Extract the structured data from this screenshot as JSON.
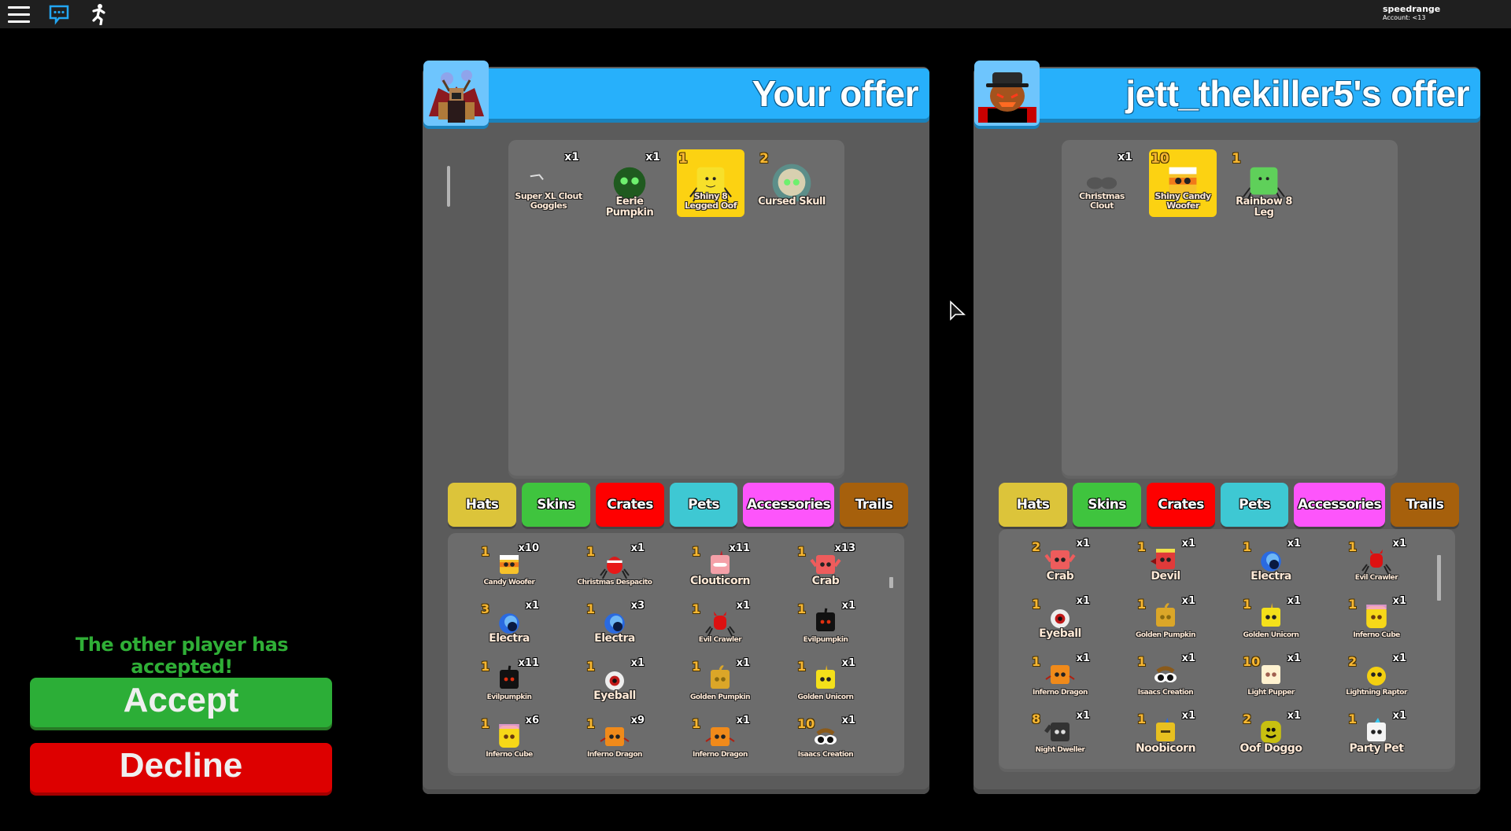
{
  "topbar": {
    "menu_icon": "hamburger-menu-icon",
    "chat_icon": "chat-icon",
    "emote_icon": "emote-running-icon",
    "account_name": "speedrange",
    "account_age": "Account: <13"
  },
  "status_message": "The other player has accepted!",
  "buttons": {
    "accept": "Accept",
    "decline": "Decline"
  },
  "colors": {
    "header_blue": "#27b0fb",
    "shiny_gold": "#fcd212",
    "tier_gold": "#f7b733",
    "accept_green": "#2cae37",
    "decline_red": "#dd0000",
    "status_green": "#2fae36"
  },
  "tabs": [
    {
      "label": "Hats",
      "color": "#dcc43a"
    },
    {
      "label": "Skins",
      "color": "#3fc43e"
    },
    {
      "label": "Crates",
      "color": "#fe0000"
    },
    {
      "label": "Pets",
      "color": "#3ec8d3"
    },
    {
      "label": "Accessories",
      "color": "#fd55fb"
    },
    {
      "label": "Trails",
      "color": "#a6600c"
    }
  ],
  "your_offer": {
    "title": "Your offer",
    "avatar": "player-avatar-speedrange",
    "offered_items": [
      {
        "name": "Super XL Clout Goggles",
        "qty": "x1",
        "tier": "",
        "shiny": false,
        "icon": "goggles"
      },
      {
        "name": "Eerie Pumpkin",
        "qty": "x1",
        "tier": "",
        "shiny": false,
        "icon": "eerie-pumpkin"
      },
      {
        "name": "Shiny 8 Legged Oof",
        "qty": "",
        "tier": "1",
        "shiny": true,
        "icon": "oof-spider"
      },
      {
        "name": "Cursed Skull",
        "qty": "",
        "tier": "2",
        "shiny": false,
        "icon": "cursed-skull"
      }
    ],
    "inventory": [
      {
        "name": "Candy Woofer",
        "tier": "1",
        "qty": "x10",
        "icon": "candy-woofer"
      },
      {
        "name": "Christmas Despacito",
        "tier": "1",
        "qty": "x1",
        "icon": "christmas-despacito"
      },
      {
        "name": "Clouticorn",
        "tier": "1",
        "qty": "x11",
        "icon": "clouticorn"
      },
      {
        "name": "Crab",
        "tier": "1",
        "qty": "x13",
        "icon": "crab"
      },
      {
        "name": "Electra",
        "tier": "3",
        "qty": "x1",
        "icon": "electra"
      },
      {
        "name": "Electra",
        "tier": "1",
        "qty": "x3",
        "icon": "electra"
      },
      {
        "name": "Evil Crawler",
        "tier": "1",
        "qty": "x1",
        "icon": "evil-crawler"
      },
      {
        "name": "Evilpumpkin",
        "tier": "1",
        "qty": "x1",
        "icon": "evilpumpkin"
      },
      {
        "name": "Evilpumpkin",
        "tier": "1",
        "qty": "x11",
        "icon": "evilpumpkin"
      },
      {
        "name": "Eyeball",
        "tier": "1",
        "qty": "x1",
        "icon": "eyeball"
      },
      {
        "name": "Golden Pumpkin",
        "tier": "1",
        "qty": "x1",
        "icon": "golden-pumpkin"
      },
      {
        "name": "Golden Unicorn",
        "tier": "1",
        "qty": "x1",
        "icon": "golden-unicorn"
      },
      {
        "name": "Inferno Cube",
        "tier": "1",
        "qty": "x6",
        "icon": "inferno-cube"
      },
      {
        "name": "Inferno Dragon",
        "tier": "1",
        "qty": "x9",
        "icon": "inferno-dragon"
      },
      {
        "name": "Inferno Dragon",
        "tier": "1",
        "qty": "x1",
        "icon": "inferno-dragon"
      },
      {
        "name": "Isaacs Creation",
        "tier": "10",
        "qty": "x1",
        "icon": "isaacs-creation"
      }
    ]
  },
  "their_offer": {
    "title": "jett_thekiller5's offer",
    "avatar": "player-avatar-jett_thekiller5",
    "offered_items": [
      {
        "name": "Christmas Clout",
        "qty": "x1",
        "tier": "",
        "shiny": false,
        "icon": "christmas-clout"
      },
      {
        "name": "Shiny Candy Woofer",
        "qty": "",
        "tier": "10",
        "shiny": true,
        "icon": "candy-woofer"
      },
      {
        "name": "Rainbow 8 Leg",
        "qty": "",
        "tier": "1",
        "shiny": false,
        "icon": "rainbow-spider"
      }
    ],
    "inventory": [
      {
        "name": "Crab",
        "tier": "2",
        "qty": "x1",
        "icon": "crab"
      },
      {
        "name": "Devil",
        "tier": "1",
        "qty": "x1",
        "icon": "devil"
      },
      {
        "name": "Electra",
        "tier": "1",
        "qty": "x1",
        "icon": "electra"
      },
      {
        "name": "Evil Crawler",
        "tier": "1",
        "qty": "x1",
        "icon": "evil-crawler"
      },
      {
        "name": "Eyeball",
        "tier": "1",
        "qty": "x1",
        "icon": "eyeball"
      },
      {
        "name": "Golden Pumpkin",
        "tier": "1",
        "qty": "x1",
        "icon": "golden-pumpkin"
      },
      {
        "name": "Golden Unicorn",
        "tier": "1",
        "qty": "x1",
        "icon": "golden-unicorn"
      },
      {
        "name": "Inferno Cube",
        "tier": "1",
        "qty": "x1",
        "icon": "inferno-cube"
      },
      {
        "name": "Inferno Dragon",
        "tier": "1",
        "qty": "x1",
        "icon": "inferno-dragon"
      },
      {
        "name": "Isaacs Creation",
        "tier": "1",
        "qty": "x1",
        "icon": "isaacs-creation"
      },
      {
        "name": "Light Pupper",
        "tier": "10",
        "qty": "x1",
        "icon": "light-pupper"
      },
      {
        "name": "Lightning Raptor",
        "tier": "2",
        "qty": "x1",
        "icon": "lightning-raptor"
      },
      {
        "name": "Night Dweller",
        "tier": "8",
        "qty": "x1",
        "icon": "night-dweller"
      },
      {
        "name": "Noobicorn",
        "tier": "1",
        "qty": "x1",
        "icon": "noobicorn"
      },
      {
        "name": "Oof Doggo",
        "tier": "2",
        "qty": "x1",
        "icon": "oof-doggo"
      },
      {
        "name": "Party Pet",
        "tier": "1",
        "qty": "x1",
        "icon": "party-pet"
      }
    ]
  }
}
